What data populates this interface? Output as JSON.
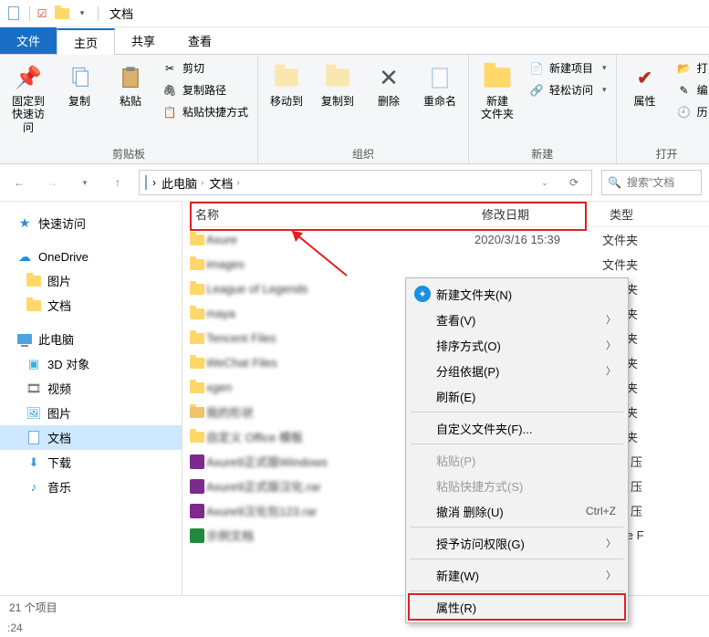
{
  "titlebar": {
    "title": "文档"
  },
  "tabs": {
    "file": "文件",
    "home": "主页",
    "share": "共享",
    "view": "查看"
  },
  "ribbon": {
    "clipboard": {
      "pinQuick": "固定到\n快速访问",
      "copy": "复制",
      "paste": "粘贴",
      "cut": "剪切",
      "copyPath": "复制路径",
      "pasteShortcut": "粘贴快捷方式",
      "label": "剪贴板"
    },
    "organize": {
      "moveTo": "移动到",
      "copyTo": "复制到",
      "delete": "删除",
      "rename": "重命名",
      "label": "组织"
    },
    "new": {
      "newFolder": "新建\n文件夹",
      "newItem": "新建项目",
      "easyAccess": "轻松访问",
      "label": "新建"
    },
    "open": {
      "properties": "属性",
      "open": "打",
      "edit": "编",
      "history": "历",
      "label": "打开"
    }
  },
  "address": {
    "thisPC": "此电脑",
    "docs": "文档",
    "refreshHint": "",
    "searchPlaceholder": "搜索\"文档"
  },
  "sidebar": {
    "quickAccess": "快速访问",
    "oneDrive": "OneDrive",
    "pictures": "图片",
    "documents": "文档",
    "thisPC": "此电脑",
    "objects3d": "3D 对象",
    "videos": "视频",
    "picturesPC": "图片",
    "documentsPC": "文档",
    "downloads": "下载",
    "music": "音乐"
  },
  "columns": {
    "name": "名称",
    "date": "修改日期",
    "type": "类型"
  },
  "files": [
    {
      "name": "Axure",
      "date": "2020/3/16 15:39",
      "type": "文件夹",
      "icon": "folder"
    },
    {
      "name": "images",
      "date": "",
      "type": "文件夹",
      "icon": "folder"
    },
    {
      "name": "League of Legends",
      "date": "",
      "type": "文件夹",
      "icon": "folder"
    },
    {
      "name": "maya",
      "date": "",
      "type": "文件夹",
      "icon": "folder"
    },
    {
      "name": "Tencent Files",
      "date": "",
      "type": "文件夹",
      "icon": "folder"
    },
    {
      "name": "WeChat Files",
      "date": "",
      "type": "文件夹",
      "icon": "folder"
    },
    {
      "name": "xgen",
      "date": "",
      "type": "文件夹",
      "icon": "folder"
    },
    {
      "name": "我的形状",
      "date": "",
      "type": "文件夹",
      "icon": "folder-alt"
    },
    {
      "name": "自定义 Office 模板",
      "date": "",
      "type": "文件夹",
      "icon": "folder"
    },
    {
      "name": "Axure9正式版Windows",
      "date": "",
      "type": "RAR 压",
      "icon": "rar"
    },
    {
      "name": "Axure9正式版汉化.rar",
      "date": "",
      "type": "RAR 压",
      "icon": "rar"
    },
    {
      "name": "Axure9汉化包123.rar",
      "date": "",
      "type": "RAR 压",
      "icon": "rar"
    },
    {
      "name": "示例文档",
      "date": "",
      "type": "Axure F",
      "icon": "xls"
    }
  ],
  "contextMenu": {
    "newFolder": "新建文件夹(N)",
    "view": "查看(V)",
    "sortBy": "排序方式(O)",
    "groupBy": "分组依据(P)",
    "refresh": "刷新(E)",
    "customize": "自定义文件夹(F)...",
    "paste": "粘贴(P)",
    "pasteShortcut": "粘贴快捷方式(S)",
    "undoDelete": "撤消 删除(U)",
    "undoShortcut": "Ctrl+Z",
    "grantAccess": "授予访问权限(G)",
    "new": "新建(W)",
    "properties": "属性(R)"
  },
  "status": {
    "itemCount": "21 个项目"
  },
  "taskbar": {
    "time": ":24"
  }
}
